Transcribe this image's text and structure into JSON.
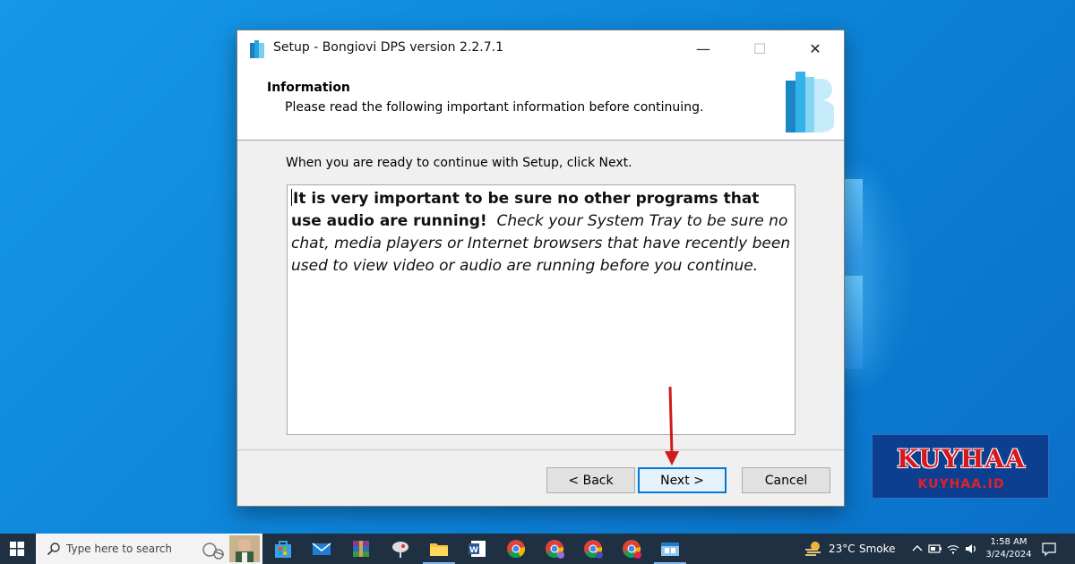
{
  "window": {
    "title": "Setup - Bongiovi DPS version 2.2.7.1",
    "minimize_glyph": "—",
    "maximize_glyph": "☐",
    "close_glyph": "✕"
  },
  "header": {
    "title": "Information",
    "subtitle": "Please read the following important information before continuing.",
    "logo_icon": "bongiovi-logo-icon"
  },
  "body": {
    "ready_text": "When you are ready to continue with Setup, click Next.",
    "info_bold": "It is very important to be sure no other programs that use audio are running!",
    "info_italic": "Check your System Tray to be sure no chat, media players or Internet browsers that have recently been used to view video or audio are running before you continue."
  },
  "buttons": {
    "back": "< Back",
    "next": "Next >",
    "cancel": "Cancel"
  },
  "watermark": {
    "main": "KUYHAA",
    "sub": "KUYHAA.ID"
  },
  "taskbar": {
    "search_placeholder": "Type here to search",
    "pinned": [
      "windows-store-icon",
      "mail-icon",
      "winrar-icon",
      "satellite-app-icon",
      "file-explorer-icon",
      "word-icon",
      "chrome-icon",
      "chrome-profile-a-icon",
      "chrome-profile-b-icon",
      "chrome-profile-k-icon",
      "setup-app-icon"
    ],
    "weather_temp": "23°C",
    "weather_desc": "Smoke",
    "time": "1:58 AM",
    "date": "3/24/2024"
  },
  "colors": {
    "accent": "#0078d7",
    "desktop": "#0d84d8",
    "taskbar": "#1f3043",
    "arrow": "#d11a1a",
    "watermark_red": "#d7171f"
  }
}
